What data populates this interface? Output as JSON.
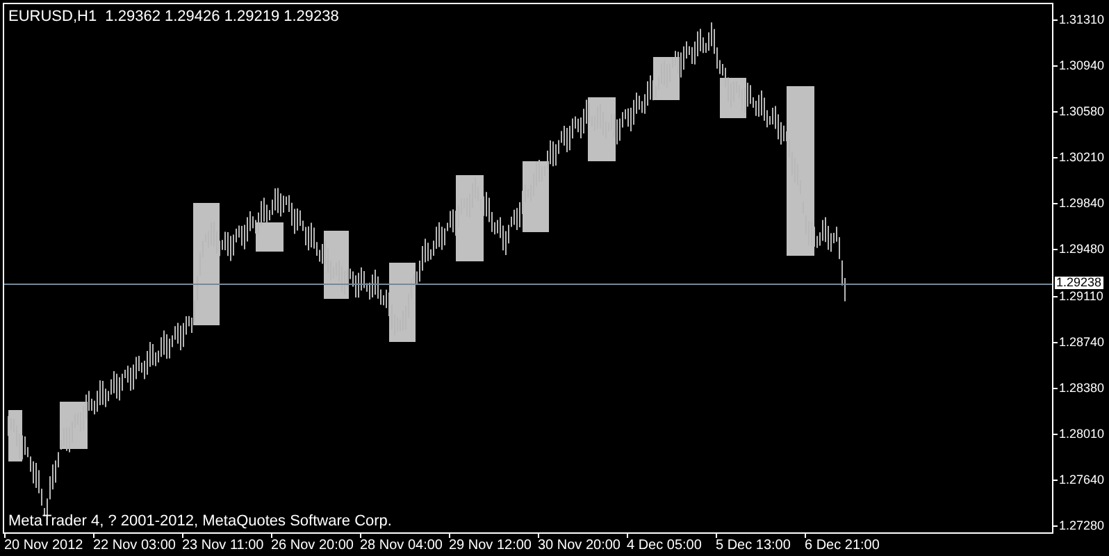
{
  "chart": {
    "header": "EURUSD,H1  1.29362 1.29426 1.29219 1.29238",
    "copyright": "MetaTrader 4, ? 2001-2012, MetaQuotes Software Corp.",
    "price_axis": [
      "1.31310",
      "1.30940",
      "1.30580",
      "1.30210",
      "1.29840",
      "1.29480",
      "1.29110",
      "1.28740",
      "1.28380",
      "1.28010",
      "1.27640",
      "1.27280"
    ],
    "current_price": "1.29238",
    "time_axis": [
      "20 Nov 2012",
      "22 Nov 03:00",
      "23 Nov 11:00",
      "26 Nov 20:00",
      "28 Nov 04:00",
      "29 Nov 12:00",
      "30 Nov 20:00",
      "4 Dec 05:00",
      "5 Dec 13:00",
      "6 Dec 21:00"
    ]
  }
}
